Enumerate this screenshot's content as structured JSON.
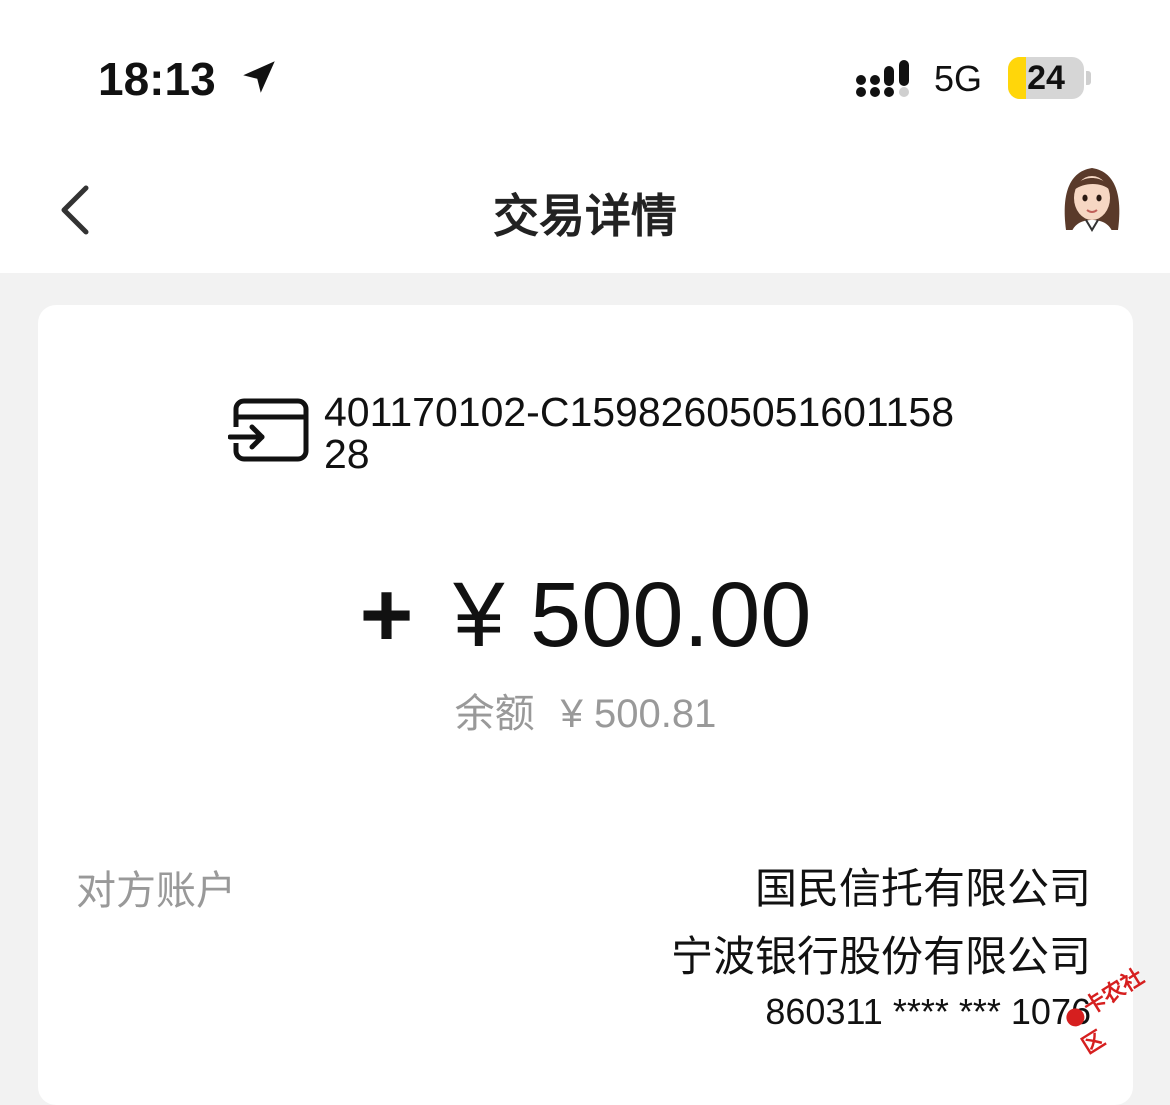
{
  "status_bar": {
    "time": "18:13",
    "location_icon": "location-arrow-icon",
    "signal_icon": "cellular-signal-icon",
    "network": "5G",
    "battery_level": "24",
    "battery_fraction": 0.24,
    "battery_color": "#ffd60a"
  },
  "nav": {
    "back_icon": "chevron-left-icon",
    "title": "交易详情",
    "avatar_icon": "assistant-avatar-icon"
  },
  "transaction": {
    "account_icon": "card-transfer-icon",
    "transaction_id": "401170102-C1598260505160115828",
    "amount_sign": "+",
    "amount": "¥ 500.00",
    "balance_label": "余额",
    "balance_value": "¥ 500.81"
  },
  "counterparty": {
    "label": "对方账户",
    "name": "国民信托有限公司",
    "bank": "宁波银行股份有限公司",
    "account_number": "860311 **** *** 1076"
  },
  "watermark": {
    "text": "卡农社区",
    "color": "#d61f1f"
  }
}
